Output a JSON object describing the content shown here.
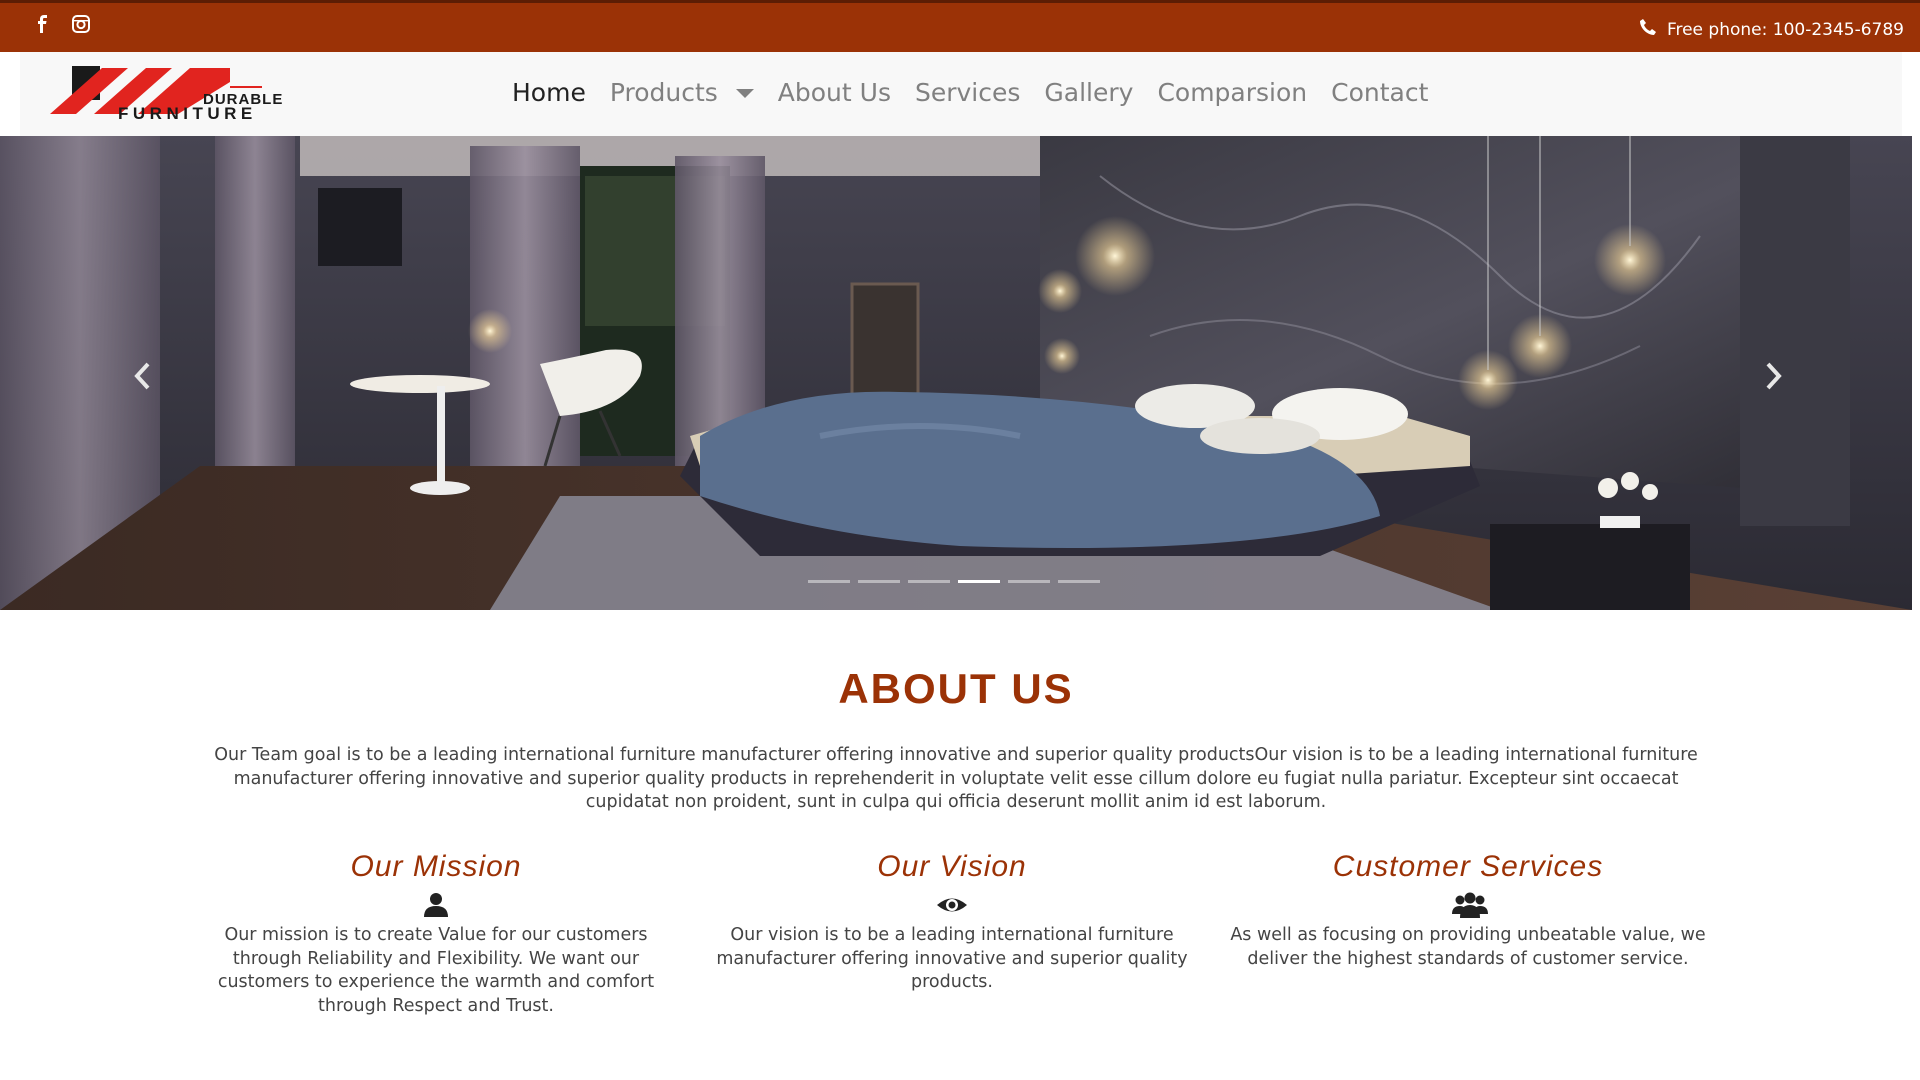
{
  "topbar": {
    "social": [
      "facebook-icon",
      "instagram-icon"
    ],
    "phone_icon": "phone-icon",
    "phone_text": "Free phone: 100-2345-6789"
  },
  "logo": {
    "line1": "DURABLE",
    "line2": "FURNITURE"
  },
  "nav": {
    "items": [
      {
        "label": "Home",
        "active": true
      },
      {
        "label": "Products",
        "dropdown": true
      },
      {
        "label": "About Us"
      },
      {
        "label": "Services"
      },
      {
        "label": "Gallery"
      },
      {
        "label": "Comparsion"
      },
      {
        "label": "Contact"
      }
    ]
  },
  "hero": {
    "prev_icon": "chevron-left-icon",
    "next_icon": "chevron-right-icon",
    "slide_count": 6,
    "active_slide": 4
  },
  "about": {
    "title": "ABOUT US",
    "text": "Our Team goal is to be a leading international furniture manufacturer offering innovative and superior quality productsOur vision is to be a leading international furniture manufacturer offering innovative and superior quality products in reprehenderit in voluptate velit esse cillum dolore eu fugiat nulla pariatur. Excepteur sint occaecat cupidatat non proident, sunt in culpa qui officia deserunt mollit anim id est laborum.",
    "columns": [
      {
        "title": "Our Mission",
        "icon": "user-icon",
        "text": "Our mission is to create Value for our customers through Reliability and Flexibility. We want our customers to experience the warmth and comfort through Respect and Trust."
      },
      {
        "title": "Our Vision",
        "icon": "eye-icon",
        "text": "Our vision is to be a leading international furniture manufacturer offering innovative and superior quality products."
      },
      {
        "title": "Customer Services",
        "icon": "users-icon",
        "text": "As well as focusing on providing unbeatable value, we deliver the highest standards of customer service."
      }
    ]
  },
  "colors": {
    "brand": "#9b3206",
    "nav_bg": "#f8f8f8",
    "text": "#444444"
  }
}
